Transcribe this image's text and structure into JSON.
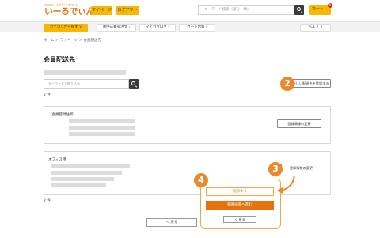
{
  "header": {
    "logo_tagline": "もれない・ミセラーにみつかる",
    "logo_text": "いーるでぃんぐ",
    "mypage_label": "マイページ",
    "logout_label": "ログアウト",
    "search_placeholder": "キーワード検索（部分一致）",
    "cart_label": "カート",
    "cart_count": "0"
  },
  "nav": {
    "category_label": "カテゴリから探す ∨",
    "quick_order_label": "お申込番号注文 ›",
    "my_catalog_label": "マイカタログ ›",
    "cart_ledger_label": "カート台帳 ›",
    "help_label": "ヘルプ ∨"
  },
  "breadcrumb": "ホーム ＞ マイページ ＞ 会員配送先",
  "page_title": "会員配送先",
  "filter": {
    "placeholder": "キーワードで絞り込み"
  },
  "count_top": "2 件",
  "count_bottom": "2 件",
  "register_new_label": "新しい配送先を登録する",
  "cards": [
    {
      "title": "［会員登録住所］",
      "button": "登録情報の変更"
    },
    {
      "title": "オフィス用",
      "button": "登録情報の変更"
    }
  ],
  "callout": {
    "delete_label": "削除する",
    "to_order_label": "購買画面へ進む",
    "back_label": "＜ 戻る"
  },
  "back_label": "＜ 戻る",
  "steps": {
    "two": "2",
    "three": "3",
    "four": "4"
  },
  "colors": {
    "accent": "#f6b800",
    "orange": "#e2730d",
    "badge": "#e98b2a"
  }
}
